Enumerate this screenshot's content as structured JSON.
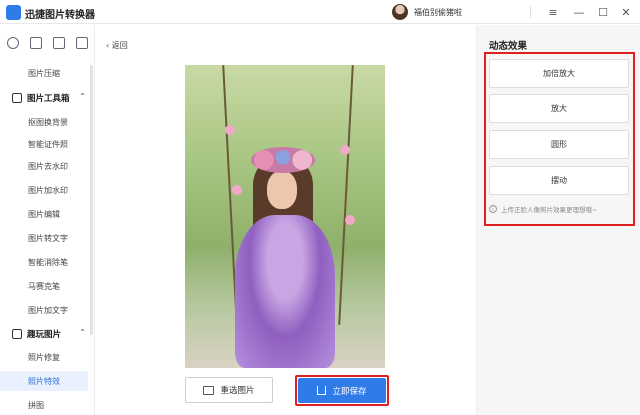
{
  "app": {
    "title": "迅捷图片转换器",
    "username": "福伯别偷猪啦",
    "window_controls": {
      "menu": "≡",
      "minimize": "—",
      "maximize": "☐",
      "close": "✕"
    }
  },
  "sidebar": {
    "top_item": "图片压缩",
    "groups": [
      {
        "label": "图片工具箱",
        "items": [
          "抠图换背景",
          "智能证件照",
          "图片去水印",
          "图片加水印",
          "图片编辑",
          "图片转文字",
          "智能消除笔",
          "马赛克笔",
          "图片加文字"
        ]
      },
      {
        "label": "趣玩图片",
        "items": [
          "照片修复",
          "照片特效",
          "拼图"
        ]
      }
    ],
    "active_item": "照片特效"
  },
  "main": {
    "back_label": "返回",
    "reselect_label": "重选图片",
    "save_label": "立即保存"
  },
  "right_panel": {
    "title": "动态效果",
    "effects": [
      "加倍放大",
      "放大",
      "圆形",
      "摆动"
    ],
    "tip": "上传正脸人像照片效果更理想哦~"
  },
  "colors": {
    "accent": "#2f7be8",
    "highlight": "#e02020",
    "active_bg": "#e9f1fe"
  }
}
